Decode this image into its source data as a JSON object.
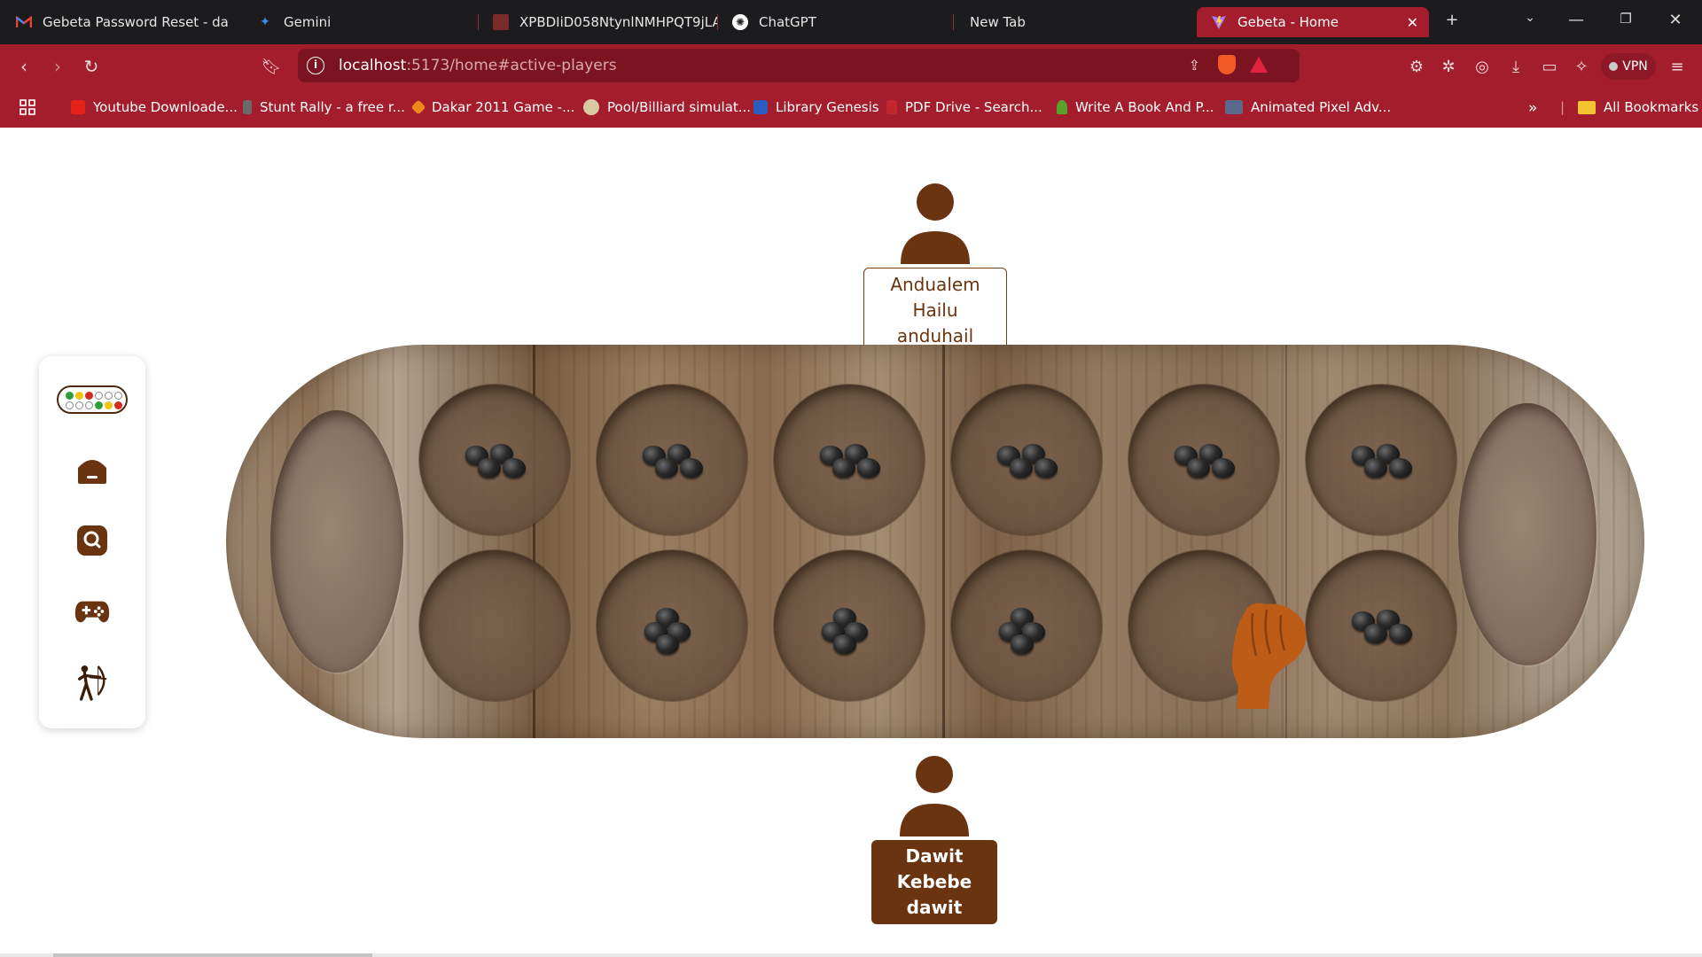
{
  "browser": {
    "tabs": [
      {
        "title": "Gebeta Password Reset - dawit",
        "favicon": "gmail-icon"
      },
      {
        "title": "Gemini",
        "favicon": "gemini-icon"
      },
      {
        "title": "XPBDIiD058NtynlNMHPQT9jLA",
        "favicon": "image-icon"
      },
      {
        "title": "ChatGPT",
        "favicon": "chatgpt-icon"
      },
      {
        "title": "New Tab",
        "favicon": ""
      },
      {
        "title": "Gebeta - Home",
        "favicon": "vite-icon",
        "active": true
      }
    ],
    "new_tab_label": "+",
    "url": {
      "host": "localhost",
      "rest": ":5173/home#active-players"
    },
    "vpn_label": "VPN",
    "bookmarks": [
      {
        "label": "Youtube Downloade...",
        "color": "#e62117"
      },
      {
        "label": "Stunt Rally - a free r...",
        "color": "#6a6a6a"
      },
      {
        "label": "Dakar 2011 Game -...",
        "color": "#f08a1c"
      },
      {
        "label": "Pool/Billiard simulat...",
        "color": "#d9c9a3"
      },
      {
        "label": "Library Genesis",
        "color": "#2b5cbf"
      },
      {
        "label": "PDF Drive - Search...",
        "color": "#c1272d"
      },
      {
        "label": "Write A Book And P...",
        "color": "#5aa02c"
      },
      {
        "label": "Animated Pixel Adv...",
        "color": "#5a6a8a"
      }
    ],
    "all_bookmarks_label": "All Bookmarks"
  },
  "sidebar": {
    "items": [
      {
        "icon": "home-icon"
      },
      {
        "icon": "search-icon"
      },
      {
        "icon": "gamepad-icon"
      },
      {
        "icon": "archer-icon"
      }
    ],
    "logo_dots": [
      "#2e9e3a",
      "#f2c40f",
      "#d42a1f",
      "#ffffff",
      "#ffffff",
      "#ffffff",
      "#ffffff",
      "#ffffff",
      "#ffffff",
      "#2e9e3a",
      "#f2c40f",
      "#d42a1f"
    ]
  },
  "players": {
    "top": {
      "full_name": "Andualem Hailu",
      "username": "anduhail"
    },
    "bottom": {
      "full_name": "Dawit Kebebe",
      "username": "dawit"
    }
  },
  "board": {
    "top_row": [
      4,
      4,
      4,
      4,
      4,
      4
    ],
    "bottom_row": [
      0,
      4,
      4,
      4,
      0,
      4
    ],
    "left_store": 0,
    "right_store": 0
  },
  "colors": {
    "accent": "#a31d2c",
    "brown": "#6b3410"
  }
}
